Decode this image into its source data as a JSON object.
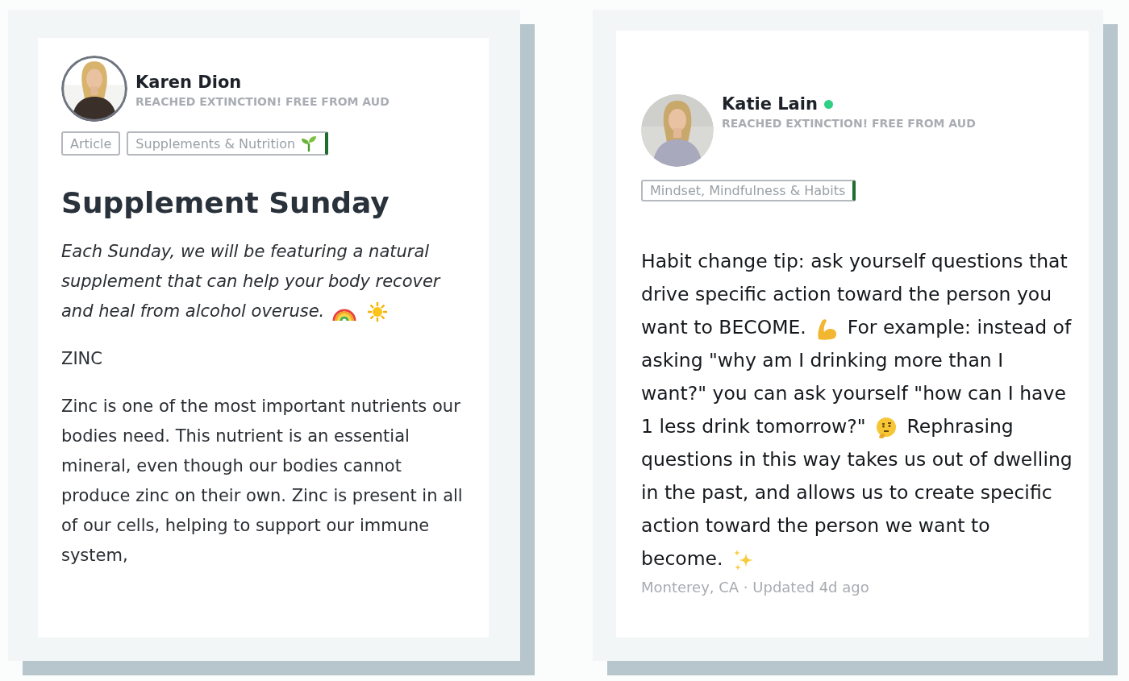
{
  "posts": [
    {
      "author": {
        "name": "Karen Dion",
        "subtitle": "REACHED EXTINCTION! FREE FROM AUD",
        "ringed": true,
        "online": false
      },
      "tags": [
        {
          "label": "Article",
          "accent": false,
          "kind": "plain"
        },
        {
          "label": "Supplements & Nutrition",
          "accent": true,
          "kind": "emoji"
        }
      ],
      "title": "Supplement Sunday",
      "blocks": [
        {
          "kind": "lead",
          "parts": [
            {
              "kind": "text",
              "text": "Each Sunday, we will be featuring a natural supplement that can help your body recover and heal from alcohol overuse."
            },
            {
              "kind": "rainbow"
            },
            {
              "kind": "sun"
            }
          ]
        },
        {
          "kind": "plain",
          "parts": [
            {
              "kind": "text",
              "text": "ZINC"
            }
          ]
        },
        {
          "kind": "plain",
          "parts": [
            {
              "kind": "text",
              "text": "Zinc is one of the most important nutrients our bodies need. This nutrient is an essential mineral, even though our bodies cannot produce zinc on their own. Zinc is present in all of our cells, helping to support our immune system,"
            }
          ]
        }
      ]
    },
    {
      "author": {
        "name": "Katie Lain",
        "subtitle": "REACHED EXTINCTION! FREE FROM AUD",
        "ringed": false,
        "online": true
      },
      "tags": [
        {
          "label": "Mindset, Mindfulness & Habits",
          "accent": true,
          "kind": "plain"
        }
      ],
      "blocks": [
        {
          "kind": "big",
          "parts": [
            {
              "kind": "text",
              "text": "Habit change tip: ask yourself questions that drive specific action toward the person you want to BECOME."
            },
            {
              "kind": "muscle"
            },
            {
              "kind": "text",
              "text": "For example: instead of asking \"why am I drinking more than I want?\" you can ask yourself \"how can I have 1 less drink tomorrow?\""
            },
            {
              "kind": "thinking"
            },
            {
              "kind": "text",
              "text": "Rephrasing questions in this way takes us out of dwelling in the past, and allows us to create specific action toward the person we want to become."
            },
            {
              "kind": "sparkles"
            }
          ]
        }
      ],
      "footer": "Monterey, CA · Updated 4d ago"
    }
  ]
}
